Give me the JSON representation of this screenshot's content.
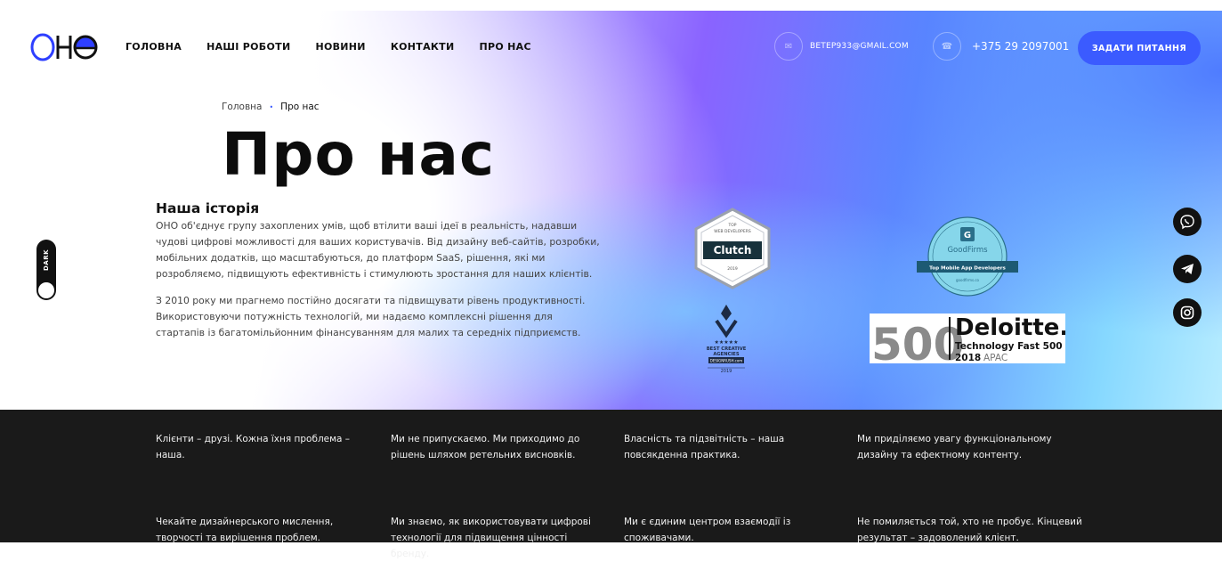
{
  "brand": {
    "logo_text": "ОНО"
  },
  "nav": {
    "items": [
      {
        "label": "ГОЛОВНА"
      },
      {
        "label": "НАШІ РОБОТИ"
      },
      {
        "label": "НОВИНИ"
      },
      {
        "label": "КОНТАКТИ"
      },
      {
        "label": "ПРО НАС"
      }
    ]
  },
  "contact": {
    "email": "BETEP933@GMAIL.COM",
    "phone": "+375 29 2097001",
    "email_icon": "mail-icon",
    "phone_icon": "phone-icon"
  },
  "header": {
    "ask_button": "ЗАДАТИ ПИТАННЯ"
  },
  "breadcrumb": {
    "home": "Головна",
    "separator": "•",
    "current": "Про нас"
  },
  "page": {
    "title": "Про нас"
  },
  "toggle": {
    "label": "DARK"
  },
  "history": {
    "heading": "Наша історія",
    "paragraph1": "ОНО об'єднує групу захоплених умів, щоб втілити ваші ідеї в реальність, надавши чудові цифрові можливості для ваших користувачів. Від дизайну веб-сайтів, розробки, мобільних додатків, що масштабуються, до платформ SaaS, рішення, які ми розробляємо, підвищують ефективність і стимулюють зростання для наших клієнтів.",
    "paragraph2": "З 2010 року ми прагнемо постійно досягати та підвищувати рівень продуктивності. Використовуючи потужність технологій, ми надаємо комплексні рішення для стартапів із багатомільйонним фінансуванням для малих та середніх підприємств."
  },
  "badges": {
    "clutch": {
      "top": "TOP",
      "sub": "WEB DEVELOPERS",
      "name": "Clutch",
      "year": "2019"
    },
    "goodfirms": {
      "name": "GoodFirms",
      "ribbon": "Top Mobile App Developers",
      "site": "goodfirms.co"
    },
    "designrush": {
      "line1": "BEST CREATIVE",
      "line2": "AGENCIES",
      "site": "DESIGNRUSH.com",
      "year": "2019"
    },
    "deloitte": {
      "number": "500",
      "name": "Deloitte.",
      "line1": "Technology Fast 500",
      "year": "2018",
      "region": "APAC"
    }
  },
  "social": [
    "viber-icon",
    "telegram-icon",
    "instagram-icon"
  ],
  "values": [
    {
      "text": "Клієнти – друзі. Кожна їхня проблема – наша."
    },
    {
      "text": "Ми не припускаємо. Ми приходимо до рішень шляхом ретельних висновків."
    },
    {
      "text": "Власність та підзвітність – наша повсякденна практика."
    },
    {
      "text": "Ми приділяємо увагу функціональному дизайну та ефектному контенту."
    },
    {
      "text": "Чекайте дизайнерського мислення, творчості та вирішення проблем."
    },
    {
      "text": "Ми знаємо, як використовувати цифрові технології для підвищення цінності бренду."
    },
    {
      "text": "Ми є єдиним центром взаємодії із споживачами."
    },
    {
      "text": "Не помиляється той, хто не пробує. Кінцевий результат – задоволений клієнт."
    }
  ],
  "colors": {
    "accent": "#3b5bff",
    "dark": "#1a1a1a"
  }
}
